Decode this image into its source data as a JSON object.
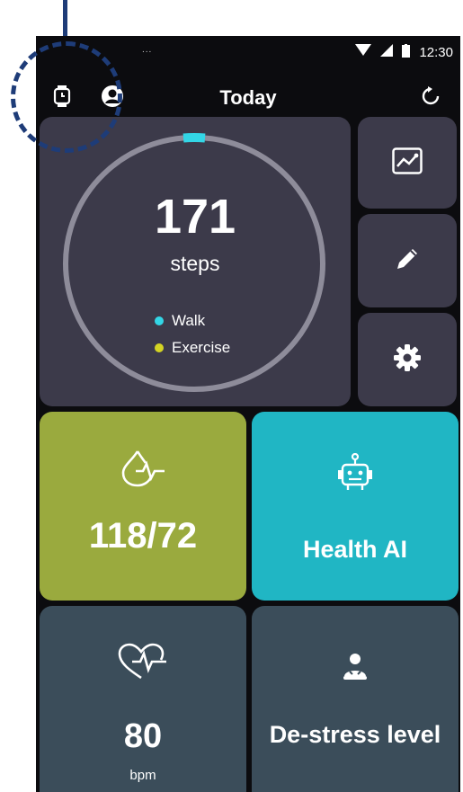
{
  "status_bar": {
    "time": "12:30",
    "notification_dots": "..."
  },
  "header": {
    "title": "Today",
    "icons": [
      "watch-icon",
      "profile-icon",
      "refresh-icon"
    ]
  },
  "steps": {
    "value": "171",
    "unit": "steps",
    "legend": [
      {
        "label": "Walk",
        "color": "#33d6e6"
      },
      {
        "label": "Exercise",
        "color": "#d4d424"
      }
    ],
    "ring_color": "#8e8c9a",
    "progress_color": "#33d6e6"
  },
  "side_buttons": [
    "chart-icon",
    "edit-icon",
    "settings-icon"
  ],
  "tiles": {
    "blood_pressure": {
      "value": "118/72",
      "color": "#9aaa3e",
      "icon": "heart-pulse-drop-icon"
    },
    "health_ai": {
      "label": "Health AI",
      "color": "#20b6c4",
      "icon": "robot-icon"
    },
    "heart_rate": {
      "value": "80",
      "unit": "bpm",
      "color": "#3b4d5a",
      "icon": "heart-rate-icon"
    },
    "destress": {
      "label": "De-stress level",
      "color": "#3b4d5a",
      "icon": "meditation-icon"
    }
  },
  "colors": {
    "screen_bg": "#0c0c0f",
    "tile_dark": "#3c3a4a",
    "annotation": "#1e3c78"
  }
}
